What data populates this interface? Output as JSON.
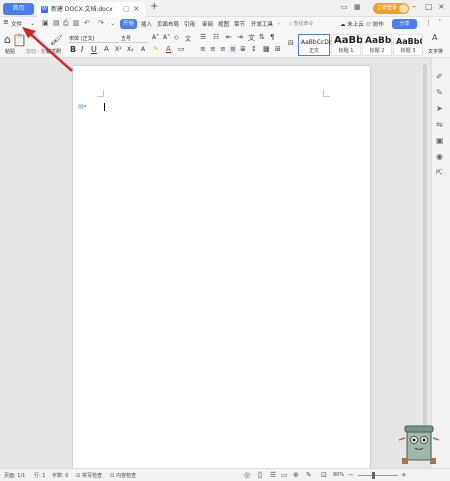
{
  "titlebar": {
    "home_tab": "首页",
    "doc_tab_icon": "W",
    "doc_tab_title": "新建 DOCX 文档.docx",
    "login_button": "立即登录",
    "icons": [
      "pin-icon",
      "close-icon",
      "add-tab-icon",
      "layout-icon",
      "grid-icon",
      "minimize-icon",
      "maximize-icon",
      "window-close-icon"
    ]
  },
  "menubar": {
    "file": "文件",
    "tabs": [
      "开始",
      "插入",
      "页面布局",
      "引用",
      "审阅",
      "视图",
      "章节",
      "开发工具"
    ],
    "active_tab": "开始",
    "search_placeholder": "查找命令",
    "cloud": "未上云",
    "collab": "协作",
    "share": "分享"
  },
  "ribbon": {
    "paste": "粘贴",
    "cut_copy": "剪切 · 复制",
    "format_painter": "格式刷",
    "font_name": "宋体 (正文)",
    "font_size": "五号",
    "styles": [
      {
        "sample": "AaBbCcDd",
        "name": "正文"
      },
      {
        "sample": "AaBb",
        "name": "标题 1"
      },
      {
        "sample": "AaBbC",
        "name": "标题 2"
      },
      {
        "sample": "AaBbC",
        "name": "标题 3"
      }
    ],
    "text_tool": "文字排"
  },
  "statusbar": {
    "page": "页面: 1/1",
    "line": "行: 1",
    "words": "字数: 0",
    "spell": "拼写检查",
    "content_check": "内容检查",
    "zoom": "90%"
  },
  "colors": {
    "accent": "#4a7df2",
    "login": "#f0a020",
    "arrow": "#e02020"
  }
}
